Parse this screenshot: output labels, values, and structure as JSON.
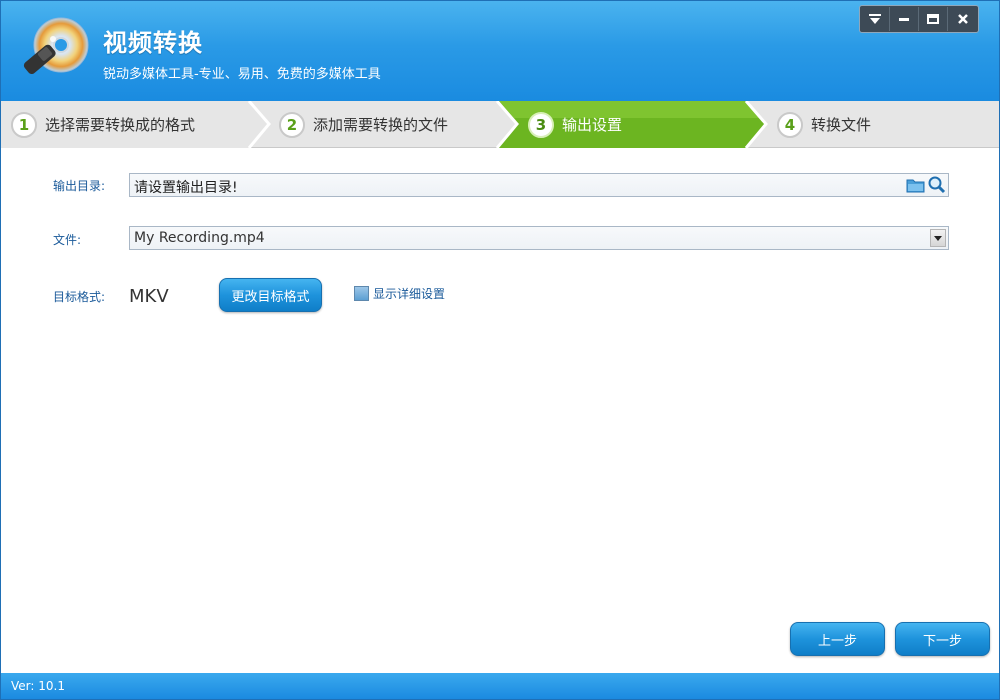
{
  "app": {
    "title": "视频转换",
    "subtitle": "锐动多媒体工具-专业、易用、免费的多媒体工具"
  },
  "window_controls": {
    "menu": "▾",
    "minimize": "–",
    "maximize": "▭",
    "close": "✕"
  },
  "steps": [
    {
      "num": "1",
      "label": "选择需要转换成的格式"
    },
    {
      "num": "2",
      "label": "添加需要转换的文件"
    },
    {
      "num": "3",
      "label": "输出设置"
    },
    {
      "num": "4",
      "label": "转换文件"
    }
  ],
  "active_step": 3,
  "form": {
    "output_dir_label": "输出目录:",
    "output_dir_value": "请设置输出目录!",
    "file_label": "文件:",
    "file_value": "My Recording.mp4",
    "target_format_label": "目标格式:",
    "target_format_value": "MKV",
    "change_format_button": "更改目标格式",
    "show_details_label": "显示详细设置",
    "show_details_checked": false
  },
  "nav": {
    "prev_button": "上一步",
    "next_button": "下一步"
  },
  "footer": {
    "version": "Ver: 10.1"
  },
  "colors": {
    "header_blue": "#2a9ae6",
    "active_step_green": "#6cb521",
    "label_blue": "#1a5a9a"
  }
}
